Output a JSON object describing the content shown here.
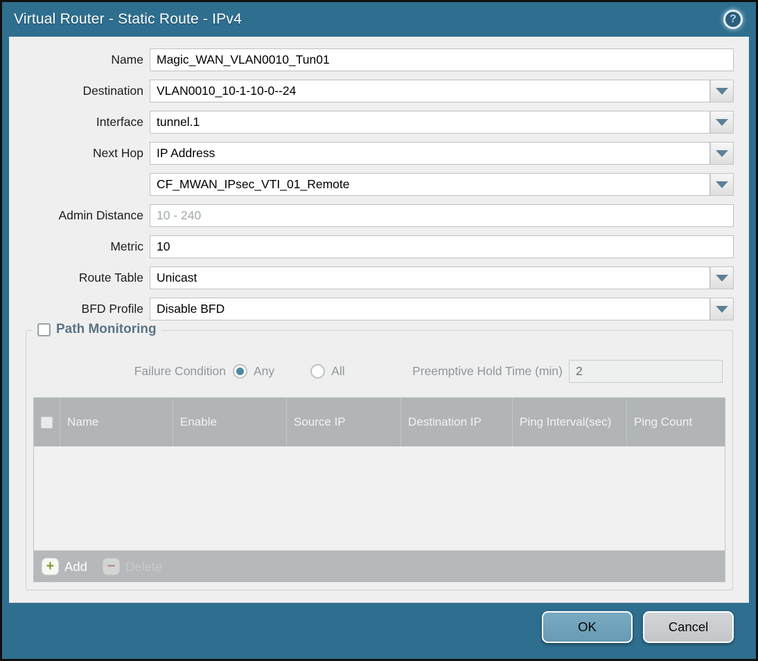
{
  "dialog": {
    "title": "Virtual Router - Static Route - IPv4",
    "help_glyph": "?"
  },
  "form": {
    "name": {
      "label": "Name",
      "value": "Magic_WAN_VLAN0010_Tun01"
    },
    "destination": {
      "label": "Destination",
      "value": "VLAN0010_10-1-10-0--24"
    },
    "interface": {
      "label": "Interface",
      "value": "tunnel.1"
    },
    "next_hop": {
      "label": "Next Hop",
      "value": "IP Address"
    },
    "next_hop_address": {
      "value": "CF_MWAN_IPsec_VTI_01_Remote"
    },
    "admin_distance": {
      "label": "Admin Distance",
      "placeholder": "10 - 240"
    },
    "metric": {
      "label": "Metric",
      "value": "10"
    },
    "route_table": {
      "label": "Route Table",
      "value": "Unicast"
    },
    "bfd_profile": {
      "label": "BFD Profile",
      "value": "Disable BFD"
    }
  },
  "path_monitoring": {
    "title": "Path Monitoring",
    "enabled": false,
    "failure_condition_label": "Failure Condition",
    "options": [
      {
        "label": "Any",
        "selected": true
      },
      {
        "label": "All",
        "selected": false
      }
    ],
    "preemptive_hold_label": "Preemptive Hold Time (min)",
    "preemptive_hold_value": "2",
    "table": {
      "columns": [
        "Name",
        "Enable",
        "Source IP",
        "Destination IP",
        "Ping Interval(sec)",
        "Ping Count"
      ],
      "rows": []
    },
    "toolbar": {
      "add_label": "Add",
      "add_glyph": "+",
      "delete_label": "Delete",
      "delete_glyph": "−"
    }
  },
  "footer": {
    "ok_label": "OK",
    "cancel_label": "Cancel"
  },
  "colors": {
    "frame_teal": "#2e6e8e",
    "panel_bg": "#efefef",
    "table_header_bg": "#b1b5b7",
    "ok_button_bg": "#6ba0b9",
    "cancel_button_bg": "#c9cccf",
    "dropdown_arrow": "#5d8096",
    "legend_text": "#5a7383"
  }
}
